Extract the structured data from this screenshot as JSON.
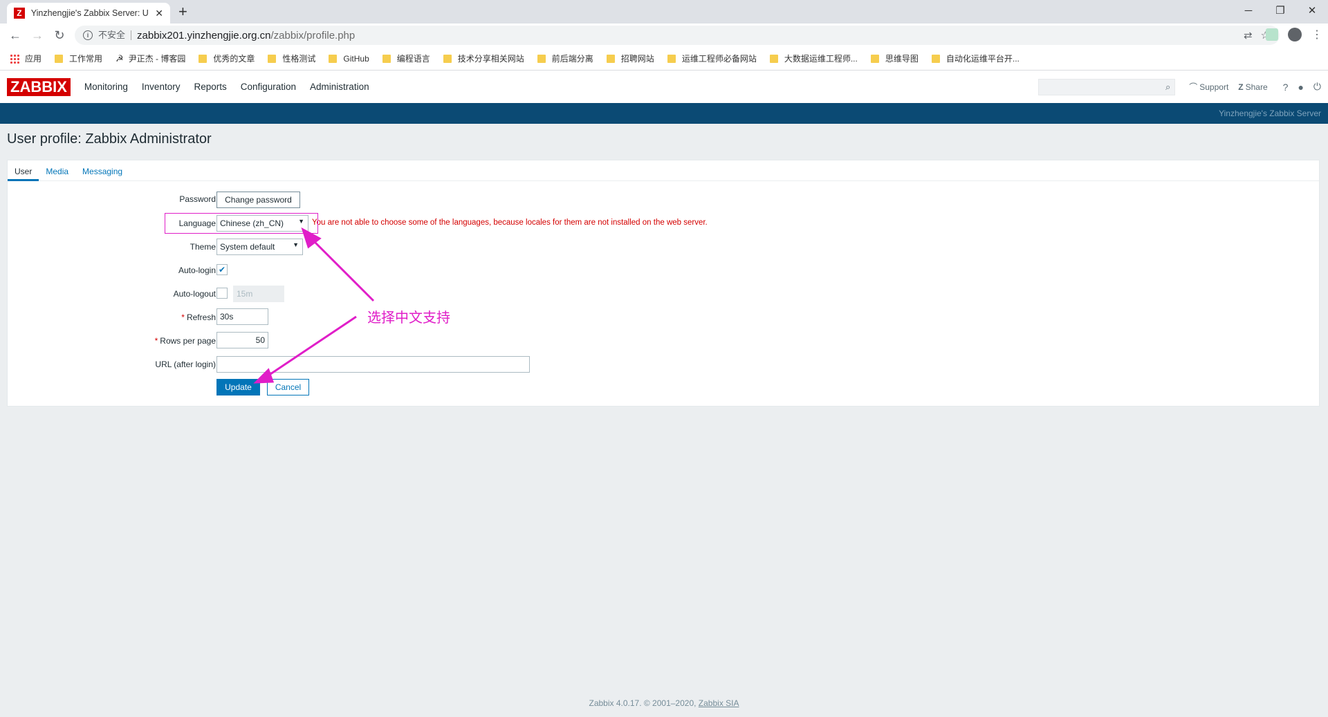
{
  "browser": {
    "tab_title": "Yinzhengjie's Zabbix Server: U",
    "favicon_letter": "Z",
    "security_label": "不安全",
    "url_host": "zabbix201.yinzhengjie.org.cn",
    "url_path": "/zabbix/profile.php",
    "bookmarks": [
      "应用",
      "工作常用",
      "尹正杰 - 博客园",
      "优秀的文章",
      "性格测试",
      "GitHub",
      "编程语言",
      "技术分享相关网站",
      "前后端分离",
      "招聘网站",
      "运维工程师必备网站",
      "大数据运维工程师...",
      "思维导图",
      "自动化运维平台开..."
    ]
  },
  "zabbix": {
    "logo": "ZABBIX",
    "menu": [
      "Monitoring",
      "Inventory",
      "Reports",
      "Configuration",
      "Administration"
    ],
    "support_label": "Support",
    "share_label": "Share",
    "help_label": "?",
    "server_name": "Yinzhengjie's Zabbix Server"
  },
  "page": {
    "title": "User profile: Zabbix Administrator",
    "tabs": [
      "User",
      "Media",
      "Messaging"
    ],
    "active_tab": "User"
  },
  "form": {
    "password_label": "Password",
    "change_password_button": "Change password",
    "language_label": "Language",
    "language_value": "Chinese (zh_CN)",
    "language_error": "You are not able to choose some of the languages, because locales for them are not installed on the web server.",
    "theme_label": "Theme",
    "theme_value": "System default",
    "autologin_label": "Auto-login",
    "autologin_checked": true,
    "autologout_label": "Auto-logout",
    "autologout_checked": false,
    "autologout_value": "15m",
    "refresh_label": "Refresh",
    "refresh_value": "30s",
    "rows_per_page_label": "Rows per page",
    "rows_per_page_value": "50",
    "url_label": "URL (after login)",
    "url_value": "",
    "update_button": "Update",
    "cancel_button": "Cancel"
  },
  "annotation": {
    "text": "选择中文支持",
    "color": "#e01ec8"
  },
  "footer": {
    "text": "Zabbix 4.0.17. © 2001–2020, ",
    "link": "Zabbix SIA"
  },
  "colors": {
    "zabbix_red": "#d40000",
    "zabbix_blue": "#0275b8",
    "header_bar": "#0b4a74"
  }
}
